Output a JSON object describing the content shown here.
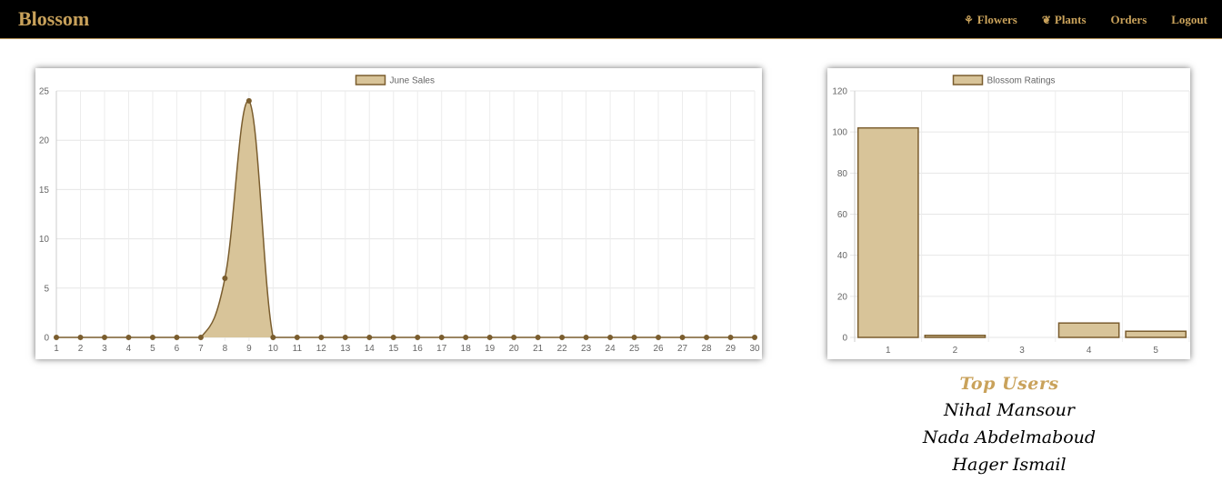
{
  "app": {
    "brand": "Blossom",
    "nav": [
      {
        "label": "Flowers",
        "icon": "flower-icon"
      },
      {
        "label": "Plants",
        "icon": "leaf-icon"
      },
      {
        "label": "Orders",
        "icon": ""
      },
      {
        "label": "Logout",
        "icon": ""
      }
    ],
    "colors": {
      "navbar_bg": "#000000",
      "accent": "#c9a25b",
      "chart_fill": "#d8c499",
      "chart_stroke": "#7a5d2e"
    }
  },
  "chart_data": [
    {
      "type": "area",
      "legend": "June Sales",
      "x": [
        1,
        2,
        3,
        4,
        5,
        6,
        7,
        8,
        9,
        10,
        11,
        12,
        13,
        14,
        15,
        16,
        17,
        18,
        19,
        20,
        21,
        22,
        23,
        24,
        25,
        26,
        27,
        28,
        29,
        30
      ],
      "values": [
        0,
        0,
        0,
        0,
        0,
        0,
        0,
        6,
        24,
        0,
        0,
        0,
        0,
        0,
        0,
        0,
        0,
        0,
        0,
        0,
        0,
        0,
        0,
        0,
        0,
        0,
        0,
        0,
        0,
        0
      ],
      "ylim": [
        0,
        25
      ],
      "yticks": [
        0,
        5,
        10,
        15,
        20,
        25
      ],
      "grid": true,
      "legend_position": "top"
    },
    {
      "type": "bar",
      "legend": "Blossom Ratings",
      "categories": [
        "1",
        "2",
        "3",
        "4",
        "5"
      ],
      "values": [
        102,
        1,
        0,
        7,
        3
      ],
      "ylim": [
        0,
        120
      ],
      "yticks": [
        0,
        20,
        40,
        60,
        80,
        100,
        120
      ],
      "grid": true,
      "legend_position": "top"
    }
  ],
  "top_users": {
    "title": "Top Users",
    "users": [
      "Nihal Mansour",
      "Nada Abdelmaboud",
      "Hager Ismail"
    ]
  }
}
